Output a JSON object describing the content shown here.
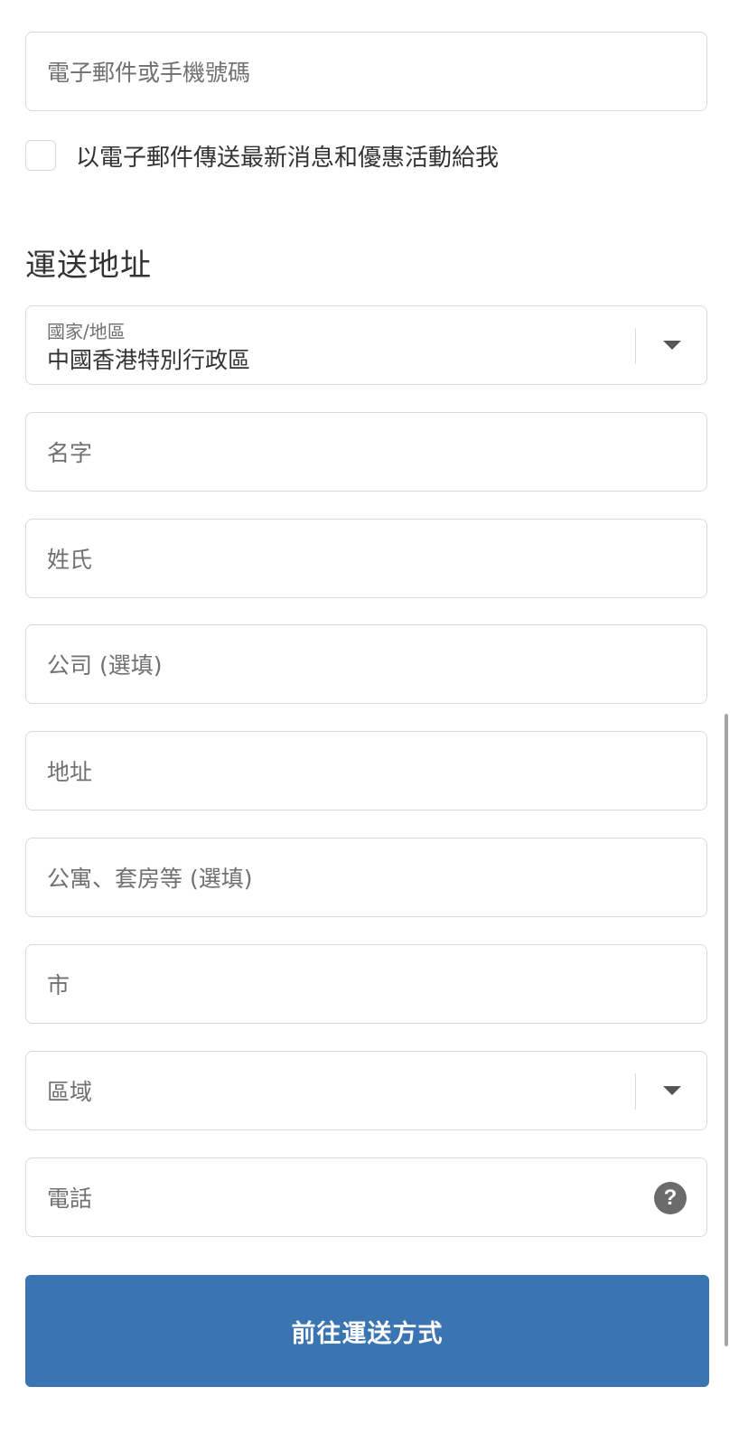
{
  "contact": {
    "email_placeholder": "電子郵件或手機號碼",
    "newsletter_label": "以電子郵件傳送最新消息和優惠活動給我"
  },
  "shipping": {
    "title": "運送地址",
    "country_label": "國家/地區",
    "country_value": "中國香港特別行政區",
    "first_name_placeholder": "名字",
    "last_name_placeholder": "姓氏",
    "company_placeholder": "公司 (選填)",
    "address_placeholder": "地址",
    "apartment_placeholder": "公寓、套房等 (選填)",
    "city_placeholder": "市",
    "region_placeholder": "區域",
    "phone_placeholder": "電話"
  },
  "actions": {
    "continue_label": "前往運送方式"
  },
  "colors": {
    "primary": "#3a74b1",
    "border": "#d9d9d9",
    "placeholder": "#707070"
  },
  "icons": {
    "help": "?"
  }
}
